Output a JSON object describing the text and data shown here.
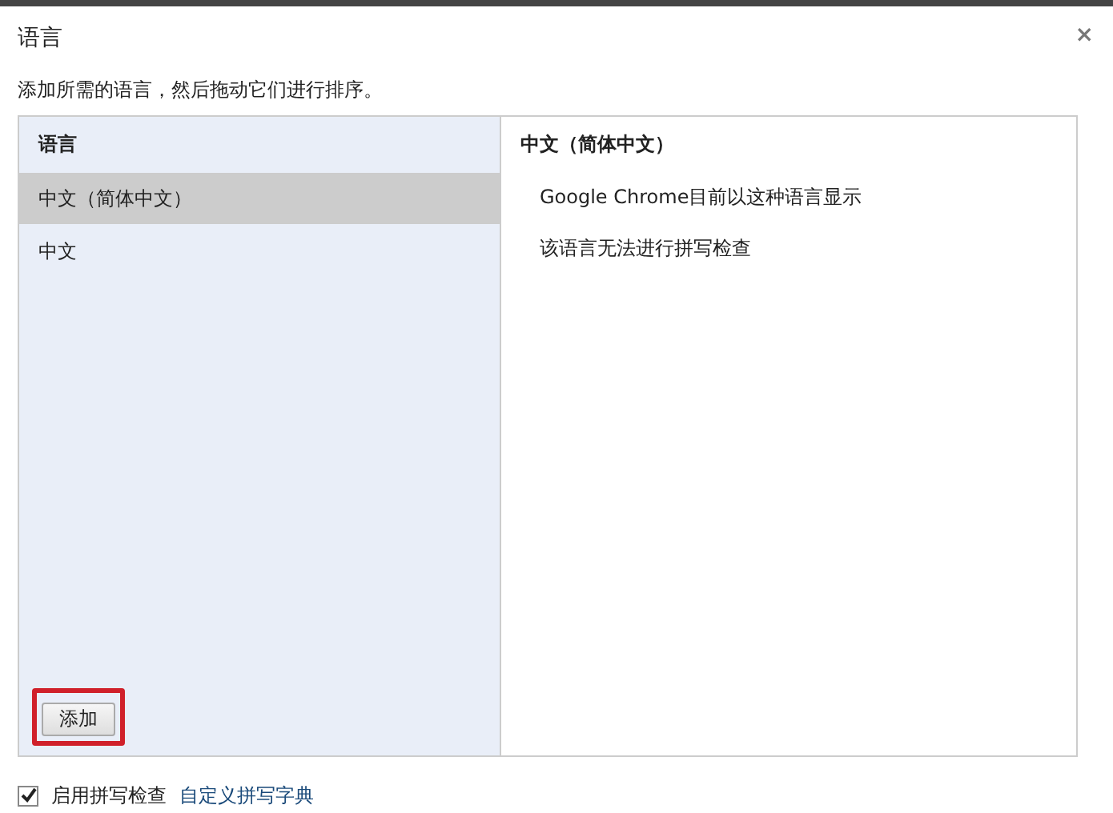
{
  "dialog": {
    "title": "语言",
    "close": "×",
    "instruction": "添加所需的语言，然后拖动它们进行排序。"
  },
  "language_list": {
    "header": "语言",
    "items": [
      {
        "label": "中文（简体中文）",
        "selected": true
      },
      {
        "label": "中文",
        "selected": false
      }
    ],
    "add_button": {
      "label": "添加",
      "highlighted": true
    }
  },
  "details": {
    "title": "中文（简体中文）",
    "lines": [
      "Google Chrome目前以这种语言显示",
      "该语言无法进行拼写检查"
    ]
  },
  "spell_check": {
    "label": "启用拼写检查",
    "checked": true,
    "link": "自定义拼写字典"
  }
}
